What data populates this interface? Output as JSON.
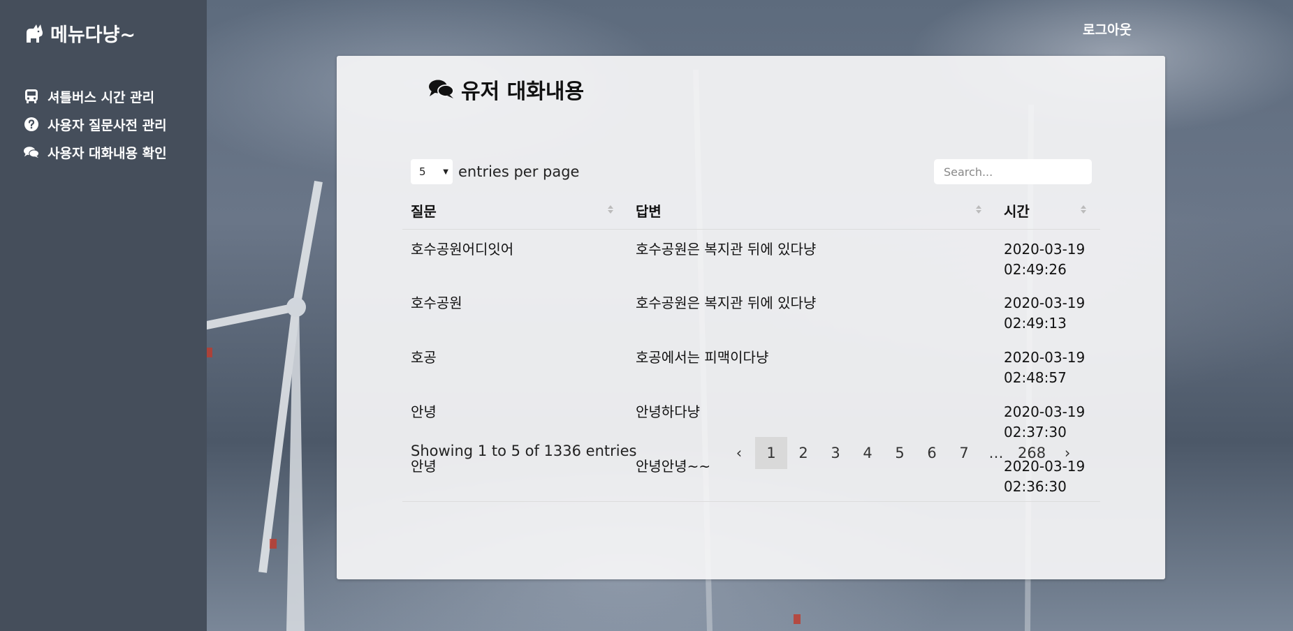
{
  "brand": {
    "name": "메뉴다냥~",
    "icon": "cat-icon"
  },
  "sidebar": {
    "items": [
      {
        "label": "셔틀버스 시간 관리",
        "icon": "bus-icon"
      },
      {
        "label": "사용자 질문사전 관리",
        "icon": "question-circle-icon"
      },
      {
        "label": "사용자 대화내용 확인",
        "icon": "comments-icon"
      }
    ]
  },
  "header": {
    "logout": "로그아웃"
  },
  "page": {
    "title": "유저 대화내용",
    "title_icon": "comments-icon"
  },
  "table_controls": {
    "per_page_value": "5",
    "per_page_label": "entries per page",
    "search_placeholder": "Search..."
  },
  "table": {
    "columns": [
      "질문",
      "답변",
      "시간"
    ],
    "rows": [
      {
        "question": "호수공원어디잇어",
        "answer": "호수공원은 복지관 뒤에 있다냥",
        "date": "2020-03-19",
        "time": "02:49:26"
      },
      {
        "question": "호수공원",
        "answer": "호수공원은 복지관 뒤에 있다냥",
        "date": "2020-03-19",
        "time": "02:49:13"
      },
      {
        "question": "호공",
        "answer": "호공에서는 피맥이다냥",
        "date": "2020-03-19",
        "time": "02:48:57"
      },
      {
        "question": "안녕",
        "answer": "안녕하다냥",
        "date": "2020-03-19",
        "time": "02:37:30"
      },
      {
        "question": "안녕",
        "answer": "안녕안녕~~",
        "date": "2020-03-19",
        "time": "02:36:30"
      }
    ]
  },
  "footer": {
    "showing": "Showing 1 to 5 of 1336 entries"
  },
  "pagination": {
    "prev": "‹",
    "pages": [
      "1",
      "2",
      "3",
      "4",
      "5",
      "6",
      "7",
      "…",
      "268"
    ],
    "active": "1",
    "next": "›"
  },
  "colors": {
    "sidebar": "#454e5b",
    "card": "#f5f5f6",
    "active_page": "#d9d9d9"
  }
}
